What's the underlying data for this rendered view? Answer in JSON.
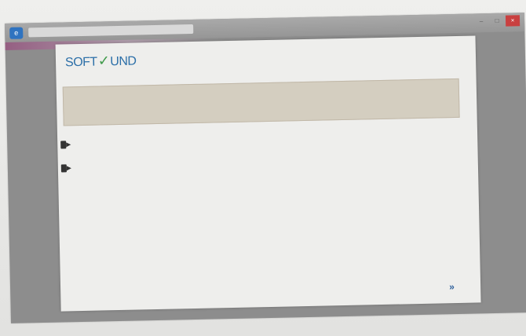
{
  "window": {
    "app_icon_label": "e",
    "tab_text": "",
    "controls": [
      "–",
      "□",
      "×"
    ]
  },
  "page": {
    "logo": {
      "left": "SOFT",
      "mark": "✓",
      "right": "UND"
    },
    "notice_text": "",
    "options": [
      {
        "label": ""
      },
      {
        "label": ""
      }
    ],
    "footer_icon": "»"
  }
}
